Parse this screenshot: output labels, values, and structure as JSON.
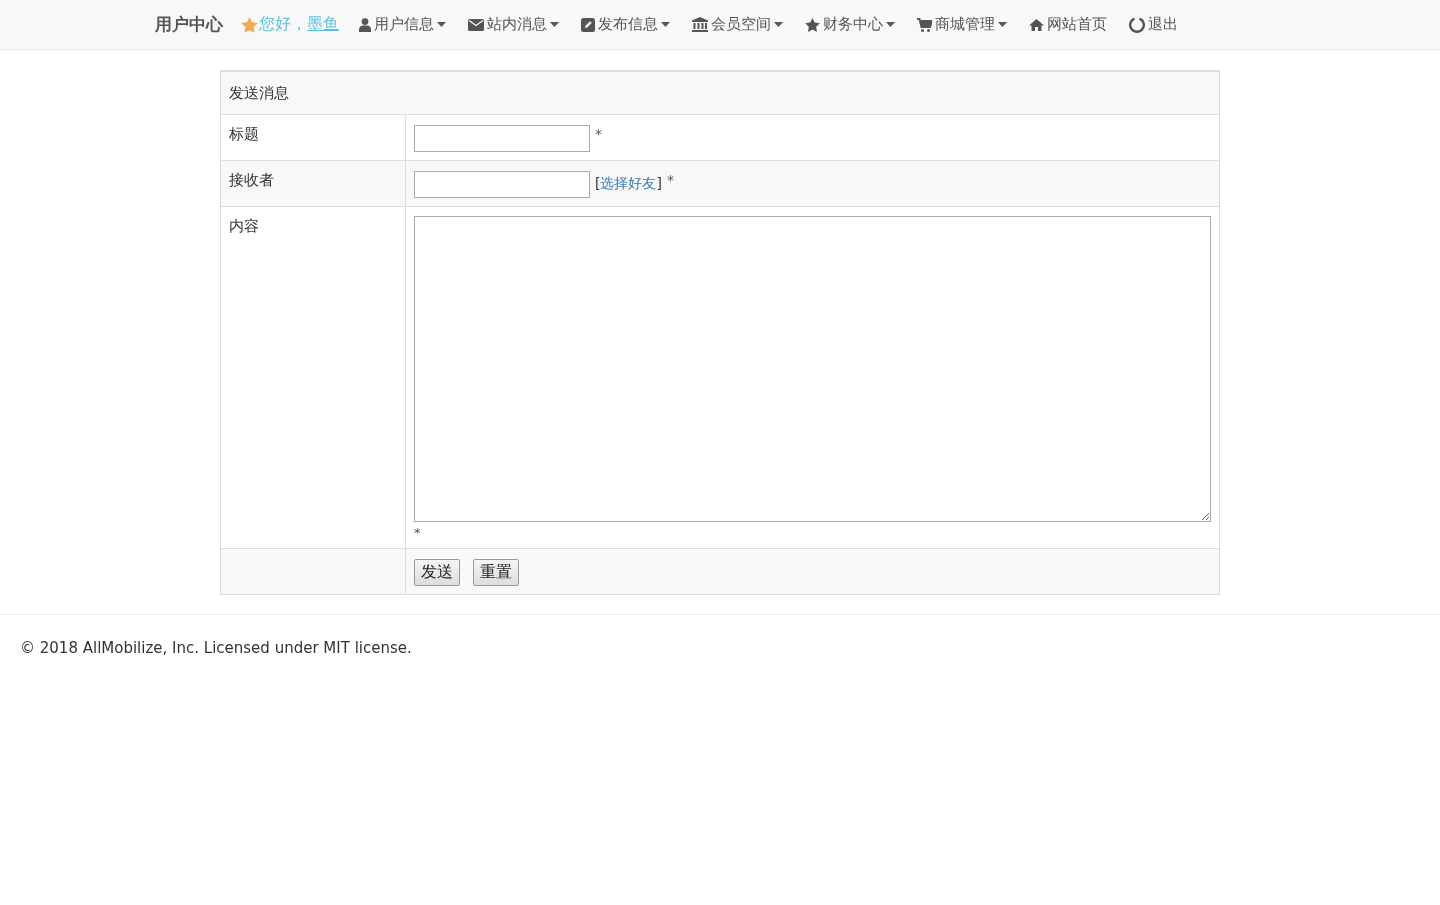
{
  "navbar": {
    "brand": "用户中心",
    "greeting": "您好，",
    "username": "墨鱼",
    "items": [
      {
        "label": "用户信息",
        "dropdown": true
      },
      {
        "label": "站内消息",
        "dropdown": true
      },
      {
        "label": "发布信息",
        "dropdown": true
      },
      {
        "label": "会员空间",
        "dropdown": true
      },
      {
        "label": "财务中心",
        "dropdown": true
      },
      {
        "label": "商城管理",
        "dropdown": true
      },
      {
        "label": "网站首页",
        "dropdown": false
      },
      {
        "label": "退出",
        "dropdown": false
      }
    ]
  },
  "form": {
    "title": "发送消息",
    "rows": [
      {
        "kind": "input",
        "label": "标题",
        "required_mark": "*"
      },
      {
        "kind": "input",
        "label": "接收者",
        "link_open": "[",
        "link": "选择好友",
        "link_close": "]",
        "required_mark": "*"
      },
      {
        "kind": "textarea",
        "label": "内容",
        "required_mark": "*"
      }
    ],
    "buttons": [
      "发送",
      "重置"
    ]
  },
  "footer": "© 2018 AllMobilize, Inc. Licensed under MIT license."
}
